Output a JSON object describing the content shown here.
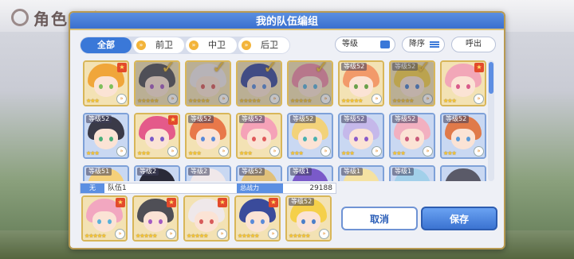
{
  "background": {
    "page_title": "角色一览"
  },
  "modal": {
    "title": "我的队伍编组"
  },
  "tabs": [
    {
      "label": "全部",
      "active": true,
      "icon": ""
    },
    {
      "label": "前卫",
      "active": false,
      "icon": "chevron-icon"
    },
    {
      "label": "中卫",
      "active": false,
      "icon": "chevron-icon"
    },
    {
      "label": "后卫",
      "active": false,
      "icon": "chevron-icon"
    }
  ],
  "sort": {
    "level_label": "等级",
    "order_label": "降序",
    "call_label": "呼出"
  },
  "grid": {
    "rows": [
      [
        {
          "level": "",
          "stars": "★★★",
          "rank_badge": "★",
          "selected": false,
          "border": "gold",
          "hair": "#f0a63a",
          "eye": "#7fbf5a"
        },
        {
          "level": "",
          "stars": "★★★★★",
          "rank_badge": "",
          "selected": true,
          "border": "gold",
          "hair": "#4f4f56",
          "eye": "#a35ac2"
        },
        {
          "level": "",
          "stars": "★★★★★",
          "rank_badge": "",
          "selected": true,
          "border": "gold",
          "hair": "#efe8ea",
          "eye": "#d75a5a"
        },
        {
          "level": "",
          "stars": "★★★★★",
          "rank_badge": "",
          "selected": true,
          "border": "gold",
          "hair": "#3a4b9b",
          "eye": "#5a8ad9"
        },
        {
          "level": "",
          "stars": "★★★★★",
          "rank_badge": "",
          "selected": true,
          "border": "gold",
          "hair": "#ef8ca6",
          "eye": "#5ab0d9"
        },
        {
          "level": "等级52",
          "stars": "★★★★★",
          "rank_badge": "",
          "selected": false,
          "border": "gold",
          "hair": "#f29a6a",
          "eye": "#6aa04a"
        },
        {
          "level": "等级52",
          "stars": "★★★★★",
          "rank_badge": "",
          "selected": true,
          "border": "gold",
          "hair": "#f5d04a",
          "eye": "#4a7fc9"
        },
        {
          "level": "",
          "stars": "★★★",
          "rank_badge": "★",
          "selected": false,
          "border": "gold",
          "hair": "#f2a7b8",
          "eye": "#d95a8a"
        }
      ],
      [
        {
          "level": "等级52",
          "stars": "★★★",
          "rank_badge": "",
          "selected": false,
          "border": "blue",
          "hair": "#3a3a48",
          "eye": "#4ab07a"
        },
        {
          "level": "",
          "stars": "★★★",
          "rank_badge": "★",
          "selected": false,
          "border": "gold",
          "hair": "#e45a8a",
          "eye": "#7a5ac9"
        },
        {
          "level": "等级52",
          "stars": "★★★",
          "rank_badge": "",
          "selected": false,
          "border": "gold",
          "hair": "#e8784a",
          "eye": "#5a8ad9"
        },
        {
          "level": "等级52",
          "stars": "★★★",
          "rank_badge": "",
          "selected": false,
          "border": "gold",
          "hair": "#f5a2b8",
          "eye": "#e05a5a"
        },
        {
          "level": "等级52",
          "stars": "★★★",
          "rank_badge": "",
          "selected": false,
          "border": "blue",
          "hair": "#f2d27a",
          "eye": "#4ab0b0"
        },
        {
          "level": "等级52",
          "stars": "★★★",
          "rank_badge": "",
          "selected": false,
          "border": "blue",
          "hair": "#c5b8ea",
          "eye": "#8a5ac9"
        },
        {
          "level": "等级52",
          "stars": "★★★",
          "rank_badge": "",
          "selected": false,
          "border": "blue",
          "hair": "#f2b0c0",
          "eye": "#c95a7a"
        },
        {
          "level": "等级52",
          "stars": "★★★",
          "rank_badge": "",
          "selected": false,
          "border": "blue",
          "hair": "#e07a4a",
          "eye": "#5a9ad9"
        }
      ],
      [
        {
          "level": "等级51",
          "stars": "",
          "rank_badge": "",
          "selected": false,
          "border": "blue",
          "hair": "#f5d07a",
          "eye": "#5a8ad9"
        },
        {
          "level": "等级2",
          "stars": "",
          "rank_badge": "",
          "selected": false,
          "border": "blue",
          "hair": "#2a2a38",
          "eye": "#5a5ac9"
        },
        {
          "level": "等级2",
          "stars": "",
          "rank_badge": "",
          "selected": false,
          "border": "blue",
          "hair": "#f0e8ea",
          "eye": "#d95a5a"
        },
        {
          "level": "等级52",
          "stars": "",
          "rank_badge": "",
          "selected": false,
          "border": "blue",
          "hair": "#e0c07a",
          "eye": "#5a8ad9"
        },
        {
          "level": "等级1",
          "stars": "",
          "rank_badge": "",
          "selected": false,
          "border": "blue",
          "hair": "#7a5ac9",
          "eye": "#c95a7a"
        },
        {
          "level": "等级1",
          "stars": "",
          "rank_badge": "",
          "selected": false,
          "border": "blue",
          "hair": "#f5e2a2",
          "eye": "#5ab07a"
        },
        {
          "level": "等级1",
          "stars": "",
          "rank_badge": "",
          "selected": false,
          "border": "blue",
          "hair": "#a2d0ea",
          "eye": "#5a8ad9"
        },
        {
          "level": "",
          "stars": "",
          "rank_badge": "",
          "selected": false,
          "border": "blue",
          "hair": "#5a5a68",
          "eye": "#d9a05a"
        }
      ]
    ]
  },
  "team_bar": {
    "slot_label": "无",
    "team_name": "队伍1",
    "power_label": "总战力",
    "power_value": "29188"
  },
  "team_slots": [
    {
      "level": "",
      "stars": "★★★★★",
      "rank_badge": "★",
      "hair": "#f2a7c0",
      "eye": "#5ab0d9"
    },
    {
      "level": "",
      "stars": "★★★★★",
      "rank_badge": "★",
      "hair": "#4f4f56",
      "eye": "#a35ac2"
    },
    {
      "level": "",
      "stars": "★★★★★",
      "rank_badge": "★",
      "hair": "#efe8ea",
      "eye": "#d75a5a"
    },
    {
      "level": "",
      "stars": "★★★★★",
      "rank_badge": "★",
      "hair": "#3a4b9b",
      "eye": "#5a8ad9"
    },
    {
      "level": "等级52",
      "stars": "★★★★★",
      "rank_badge": "",
      "hair": "#f5d04a",
      "eye": "#4a7fc9"
    }
  ],
  "buttons": {
    "cancel_label": "取消",
    "save_label": "保存"
  },
  "colors": {
    "accent": "#3a78d8",
    "frame_gold": "#b89a52",
    "title_bar": "#3a6fcf"
  }
}
